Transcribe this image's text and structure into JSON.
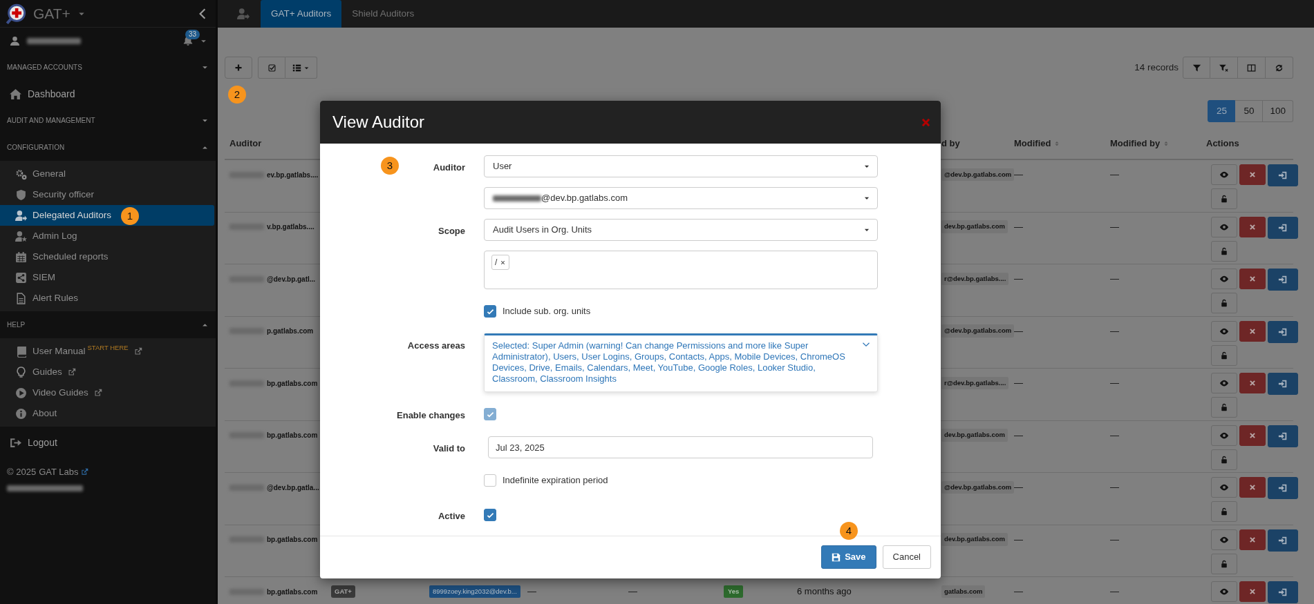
{
  "sidebar": {
    "brand": "GAT+",
    "notification_count": "33",
    "entries": [
      {
        "kind": "section",
        "title": "MANAGED ACCOUNTS",
        "expanded": false
      },
      {
        "kind": "link",
        "label": "Dashboard"
      },
      {
        "kind": "section",
        "title": "AUDIT AND MANAGEMENT",
        "expanded": false
      },
      {
        "kind": "section",
        "title": "CONFIGURATION",
        "expanded": true,
        "children": [
          {
            "label": "General",
            "selected": false
          },
          {
            "label": "Security officer",
            "selected": false
          },
          {
            "label": "Delegated Auditors",
            "selected": true
          },
          {
            "label": "Admin Log",
            "selected": false
          },
          {
            "label": "Scheduled reports",
            "selected": false
          },
          {
            "label": "SIEM",
            "selected": false
          },
          {
            "label": "Alert Rules",
            "selected": false
          }
        ]
      },
      {
        "kind": "section",
        "title": "HELP",
        "expanded": true,
        "children": [
          {
            "label": "User Manual",
            "tag": "START HERE",
            "external": true,
            "selected": false
          },
          {
            "label": "Guides",
            "external": true,
            "selected": false
          },
          {
            "label": "Video Guides",
            "external": true,
            "selected": false
          },
          {
            "label": "About",
            "external": false,
            "selected": false
          }
        ]
      },
      {
        "kind": "link",
        "label": "Logout"
      }
    ],
    "footer": {
      "copyright": "© 2025",
      "link": "GAT Labs"
    }
  },
  "tabs": [
    {
      "label": "GAT+ Auditors",
      "selected": true
    },
    {
      "label": "Shield Auditors",
      "selected": false
    }
  ],
  "toolbar": {
    "records": "14 records",
    "page_sizes": [
      {
        "label": "25",
        "selected": true
      },
      {
        "label": "50",
        "selected": false
      },
      {
        "label": "100",
        "selected": false
      }
    ]
  },
  "table": {
    "columns": [
      {
        "label": "Auditor",
        "sortable": false
      },
      {
        "label": "d by",
        "sortable": false
      },
      {
        "label": "Modified",
        "sortable": true
      },
      {
        "label": "Modified by",
        "sortable": true
      },
      {
        "label": "Actions",
        "sortable": false
      }
    ],
    "rows": [
      {
        "auditor": "ev.bp.gatlabs....",
        "created_by": "@dev.bp.gatlabs.com",
        "modified": "—",
        "modified_by": "—"
      },
      {
        "auditor": "v.bp.gatlabs....",
        "created_by": "dev.bp.gatlabs.com",
        "modified": "—",
        "modified_by": "—"
      },
      {
        "auditor": "@dev.bp.gatl...",
        "created_by": "r@dev.bp.gatlabs....",
        "modified": "—",
        "modified_by": "—"
      },
      {
        "auditor": "p.gatlabs.com",
        "created_by": "@dev.bp.gatlabs.com",
        "modified": "—",
        "modified_by": "—"
      },
      {
        "auditor": "bp.gatlabs.com",
        "created_by": "r@dev.bp.gatlabs....",
        "modified": "—",
        "modified_by": "—"
      },
      {
        "auditor": "bp.gatlabs.com",
        "created_by": "dev.bp.gatlabs.com",
        "modified": "—",
        "modified_by": "—"
      },
      {
        "auditor": "@dev.bp.gatla...",
        "created_by": "@dev.bp.gatlabs.com",
        "modified": "—",
        "modified_by": "—"
      },
      {
        "auditor": "bp.gatlabs.com",
        "created_by": "dev.bp.gatlabs.com",
        "modified": "—",
        "modified_by": "—"
      },
      {
        "auditor": "bp.gatlabs.com",
        "type": "GAT+",
        "email": "8999zoey.king2032@dev.b...",
        "column_4": "—",
        "column_5": "—",
        "active": "Yes",
        "created": "6 months ago",
        "created_by": "gatlabs.com",
        "modified": "—",
        "modified_by": "—"
      }
    ]
  },
  "modal": {
    "title": "View Auditor",
    "fields": [
      {
        "kind": "select",
        "label": "Auditor",
        "value": "User"
      },
      {
        "kind": "select",
        "value": "@dev.bp.gatlabs.com",
        "redacted": true
      },
      {
        "kind": "select",
        "label": "Scope",
        "value": "Audit Users in Org. Units"
      },
      {
        "kind": "tags",
        "tags": [
          "/"
        ]
      },
      {
        "kind": "checkbox",
        "text": "Include sub. org. units",
        "checked": true,
        "disabled": false
      },
      {
        "kind": "multiselect",
        "label": "Access areas",
        "value": "Selected: Super Admin (warning! Can change Permissions and more like Super Administrator), Users, User Logins, Groups, Contacts, Apps, Mobile Devices, ChromeOS Devices, Drive, Emails, Calendars, Meet, YouTube, Google Roles, Looker Studio, Classroom, Classroom Insights"
      },
      {
        "kind": "checkbox",
        "label": "Enable changes",
        "checked": true,
        "disabled": true
      },
      {
        "kind": "date",
        "label": "Valid to",
        "value": "Jul 23, 2025"
      },
      {
        "kind": "checkbox",
        "text": "Indefinite expiration period",
        "checked": false,
        "disabled": false
      },
      {
        "kind": "checkbox",
        "label": "Active",
        "checked": true,
        "disabled": false
      }
    ],
    "buttons": [
      {
        "label": "Save",
        "kind": "primary"
      },
      {
        "label": "Cancel",
        "kind": "default"
      }
    ]
  },
  "callouts": [
    {
      "number": "1"
    },
    {
      "number": "2"
    },
    {
      "number": "3"
    },
    {
      "number": "4"
    }
  ]
}
